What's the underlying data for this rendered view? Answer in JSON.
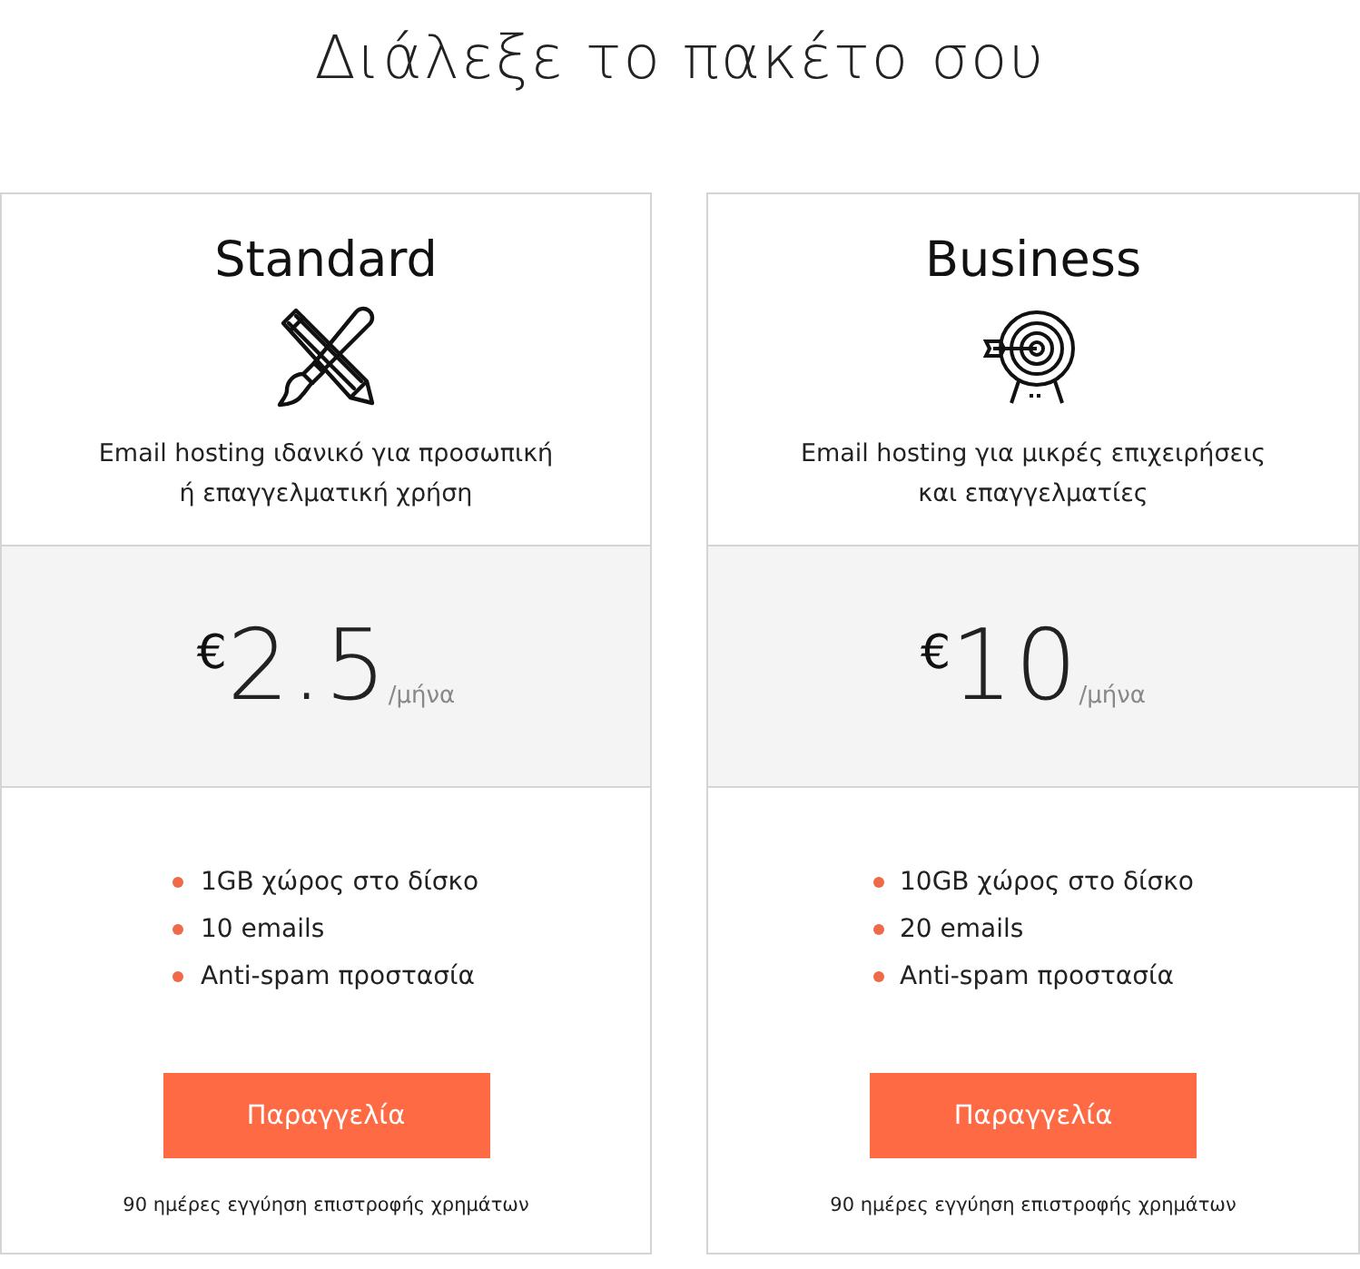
{
  "heading": "Διάλεξε το πακέτο σου",
  "plans": [
    {
      "name": "Standard",
      "description": [
        "Email hosting ιδανικό για προσωπική",
        "ή επαγγελματική χρήση"
      ],
      "price": {
        "currency": "€",
        "amount": "2.5",
        "period": "/μήνα"
      },
      "features": [
        "1GB χώρος στο δίσκο",
        "10 emails",
        "Anti-spam προστασία"
      ],
      "button": "Παραγγελία",
      "guarantee": "90 ημέρες εγγύηση επιστροφής χρημάτων"
    },
    {
      "name": "Business",
      "description": [
        "Email hosting για μικρές επιχειρήσεις",
        "και επαγγελματίες"
      ],
      "price": {
        "currency": "€",
        "amount": "10",
        "period": "/μήνα"
      },
      "features": [
        "10GB χώρος στο δίσκο",
        "20 emails",
        "Anti-spam προστασία"
      ],
      "button": "Παραγγελία",
      "guarantee": "90 ημέρες εγγύηση επιστροφής χρημάτων"
    }
  ]
}
